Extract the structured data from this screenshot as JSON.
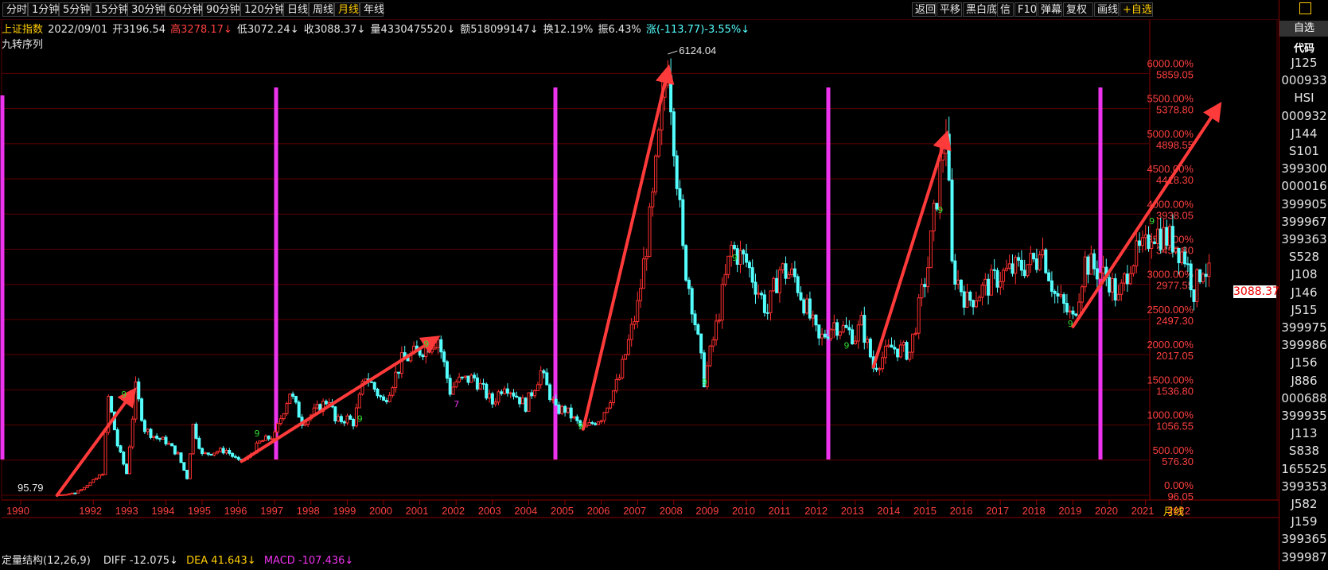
{
  "toolbar": {
    "periods": [
      "分时",
      "1分钟",
      "5分钟",
      "15分钟",
      "30分钟",
      "60分钟",
      "90分钟",
      "120分钟",
      "日线",
      "周线",
      "月线",
      "年线"
    ],
    "active_period": "月线",
    "tools": [
      "返回",
      "平移",
      "黑白底",
      "信",
      "F10",
      "弹幕",
      "复权",
      "画线",
      "+自选"
    ]
  },
  "info": {
    "name": "上证指数",
    "date": "2022/09/01",
    "open": "开3196.54",
    "high": "高3278.17↓",
    "low": "低3072.24↓",
    "close": "收3088.37↓",
    "volume": "量4330475520↓",
    "amount": "额518099147↓",
    "turnover": "换12.19%",
    "amplitude": "振6.43%",
    "change": "涨(-113.77)-3.55%↓"
  },
  "indicator_name": "九转序列",
  "colors": {
    "up": "#ff3030",
    "down": "#54ffff",
    "grid": "#5a0000",
    "marker": "#ee33ee",
    "arrow": "#ff3a3a",
    "label_red": "#ff4040",
    "seq_green": "#33dd33"
  },
  "chart_data": {
    "type": "candlestick",
    "title": "上证指数 月线",
    "x_axis": {
      "ticks": [
        "1990",
        "1992",
        "1993",
        "1994",
        "1995",
        "1996",
        "1997",
        "1998",
        "1999",
        "2000",
        "2001",
        "2002",
        "2003",
        "2004",
        "2005",
        "2006",
        "2007",
        "2008",
        "2009",
        "2010",
        "2011",
        "2012",
        "2013",
        "2014",
        "2015",
        "2016",
        "2017",
        "2018",
        "2019",
        "2020",
        "2021",
        "2022"
      ],
      "period_label": "月线"
    },
    "y_axis": {
      "percent_labels": [
        "6000.00%",
        "5500.00%",
        "5000.00%",
        "4500.00%",
        "4000.00%",
        "3500.00%",
        "3000.00%",
        "2500.00%",
        "2000.00%",
        "1500.00%",
        "1000.00%",
        "500.00%",
        "0.00%"
      ],
      "price_labels": [
        "5859.05",
        "5378.80",
        "4898.55",
        "4418.30",
        "3938.05",
        "3457.80",
        "2977.55",
        "2497.30",
        "2017.05",
        "1536.80",
        "1056.55",
        "576.30",
        "96.05"
      ],
      "range": [
        96.05,
        6124.04
      ]
    },
    "series": [
      {
        "name": "上证指数",
        "points": [
          [
            "1990-12",
            96.05
          ],
          [
            "1991-06",
            130
          ],
          [
            "1991-12",
            293
          ],
          [
            "1992-03",
            400
          ],
          [
            "1992-05",
            1429
          ],
          [
            "1992-08",
            780
          ],
          [
            "1992-11",
            393
          ],
          [
            "1993-02",
            1558
          ],
          [
            "1993-05",
            1000
          ],
          [
            "1993-09",
            880
          ],
          [
            "1993-12",
            833
          ],
          [
            "1994-04",
            650
          ],
          [
            "1994-07",
            333
          ],
          [
            "1994-09",
            1052
          ],
          [
            "1994-12",
            647
          ],
          [
            "1995-05",
            700
          ],
          [
            "1995-08",
            710
          ],
          [
            "1995-12",
            555
          ],
          [
            "1996-03",
            600
          ],
          [
            "1996-07",
            820
          ],
          [
            "1996-12",
            917
          ],
          [
            "1997-05",
            1510
          ],
          [
            "1997-09",
            1100
          ],
          [
            "1997-12",
            1194
          ],
          [
            "1998-06",
            1420
          ],
          [
            "1998-08",
            1100
          ],
          [
            "1998-12",
            1147
          ],
          [
            "1999-02",
            1090
          ],
          [
            "1999-06",
            1739
          ],
          [
            "1999-12",
            1367
          ],
          [
            "2000-06",
            1930
          ],
          [
            "2000-12",
            2073
          ],
          [
            "2001-06",
            2245
          ],
          [
            "2001-10",
            1520
          ],
          [
            "2001-12",
            1646
          ],
          [
            "2002-06",
            1700
          ],
          [
            "2002-12",
            1357
          ],
          [
            "2003-04",
            1630
          ],
          [
            "2003-11",
            1320
          ],
          [
            "2004-04",
            1783
          ],
          [
            "2004-09",
            1260
          ],
          [
            "2004-12",
            1267
          ],
          [
            "2005-06",
            1000
          ],
          [
            "2005-12",
            1161
          ],
          [
            "2006-06",
            1700
          ],
          [
            "2006-12",
            2675
          ],
          [
            "2007-05",
            4100
          ],
          [
            "2007-10",
            6124.04
          ],
          [
            "2008-03",
            3400
          ],
          [
            "2008-06",
            2736
          ],
          [
            "2008-10",
            1664
          ],
          [
            "2009-02",
            2400
          ],
          [
            "2009-07",
            3478
          ],
          [
            "2009-12",
            3277
          ],
          [
            "2010-07",
            2600
          ],
          [
            "2010-11",
            3186
          ],
          [
            "2011-04",
            3067
          ],
          [
            "2011-12",
            2199
          ],
          [
            "2012-05",
            2450
          ],
          [
            "2012-12",
            2269
          ],
          [
            "2013-02",
            2444
          ],
          [
            "2013-06",
            1849
          ],
          [
            "2013-12",
            2116
          ],
          [
            "2014-06",
            2048
          ],
          [
            "2014-12",
            3234
          ],
          [
            "2015-06",
            5178
          ],
          [
            "2015-08",
            3205
          ],
          [
            "2016-01",
            2738
          ],
          [
            "2016-12",
            3104
          ],
          [
            "2017-12",
            3307
          ],
          [
            "2018-01",
            3587
          ],
          [
            "2018-06",
            2847
          ],
          [
            "2018-12",
            2493
          ],
          [
            "2019-04",
            3288
          ],
          [
            "2019-12",
            3050
          ],
          [
            "2020-03",
            2750
          ],
          [
            "2020-07",
            3310
          ],
          [
            "2020-12",
            3473
          ],
          [
            "2021-02",
            3731
          ],
          [
            "2021-09",
            3568
          ],
          [
            "2022-01",
            3361
          ],
          [
            "2022-04",
            2886
          ],
          [
            "2022-07",
            3253
          ],
          [
            "2022-09",
            3088.37
          ]
        ]
      }
    ],
    "annotations": {
      "max_label": "6124.04",
      "min_label": "95.79",
      "current_price": "3088.37",
      "vertical_markers_years": [
        "1990",
        "1998",
        "2006",
        "2014",
        "2021"
      ],
      "trend_arrows": [
        {
          "from": [
            "1990-12",
            96
          ],
          "to": [
            "1993-01",
            1500
          ]
        },
        {
          "from": [
            "1996-01",
            560
          ],
          "to": [
            "2001-05",
            2230
          ]
        },
        {
          "from": [
            "2005-06",
            1000
          ],
          "to": [
            "2007-10",
            5900
          ]
        },
        {
          "from": [
            "2013-06",
            1850
          ],
          "to": [
            "2015-06",
            5000
          ]
        },
        {
          "from": [
            "2018-12",
            2400
          ],
          "to": [
            "2022-12",
            5400
          ]
        }
      ],
      "nine_sequence_labels": [
        "9",
        "9",
        "9",
        "9",
        "9",
        "9",
        "9",
        "9",
        "9",
        "9",
        "9",
        "7"
      ]
    }
  },
  "bottom": {
    "name": "定量结构(12,26,9)",
    "diff": "DIFF -12.075↓",
    "dea": "DEA 41.643↓",
    "macd": "MACD -107.436↓"
  },
  "sidebar": {
    "header": "自选",
    "subheader": "代码",
    "codes": [
      "J125",
      "000933",
      "HSI",
      "000932",
      "J144",
      "S101",
      "399300",
      "000016",
      "399905",
      "399967",
      "399363",
      "S528",
      "J108",
      "J146",
      "J515",
      "399975",
      "399986",
      "J156",
      "J886",
      "000688",
      "399935",
      "J113",
      "S838",
      "165525",
      "399353",
      "J582",
      "J159",
      "399365",
      "399987"
    ]
  }
}
